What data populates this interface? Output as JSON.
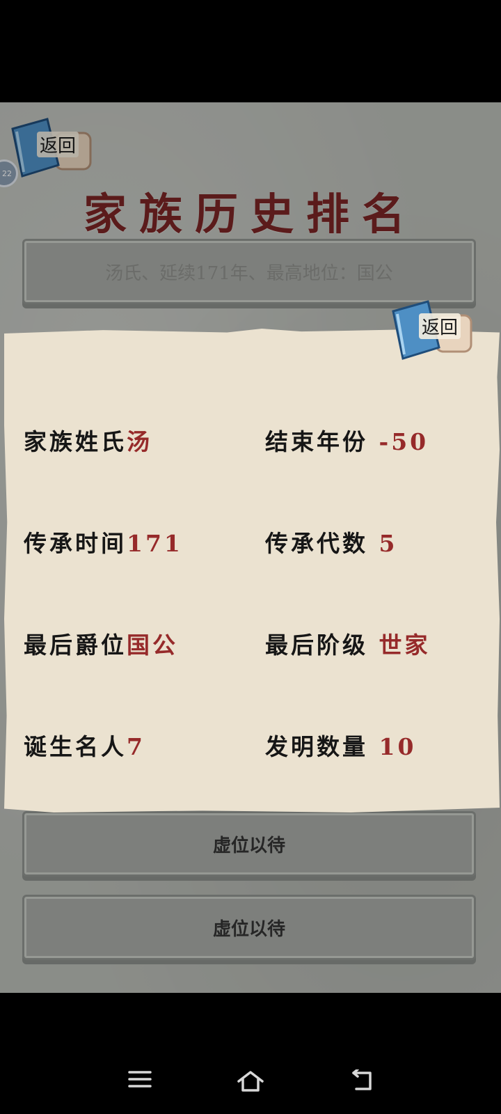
{
  "header": {
    "back_label": "返回",
    "title": "家族历史排名"
  },
  "ranking": {
    "rows": [
      "汤氏、延续171年、最高地位：国公",
      "虚位以待",
      "虚位以待"
    ]
  },
  "detail_panel": {
    "back_label": "返回",
    "stats": [
      {
        "label": "家族姓氏",
        "value": "汤"
      },
      {
        "label": "结束年份 ",
        "value": "-50"
      },
      {
        "label": "传承时间",
        "value": "171"
      },
      {
        "label": "传承代数 ",
        "value": "5"
      },
      {
        "label": "最后爵位",
        "value": "国公"
      },
      {
        "label": "最后阶级 ",
        "value": "世家"
      },
      {
        "label": "诞生名人",
        "value": "7"
      },
      {
        "label": "发明数量 ",
        "value": "10"
      }
    ]
  },
  "colors": {
    "title": "#7a2424",
    "value": "#962a2a",
    "panel_bg": "#ebe2d0"
  },
  "icons": [
    "book-scroll-icon",
    "menu-icon",
    "home-icon",
    "back-icon"
  ]
}
